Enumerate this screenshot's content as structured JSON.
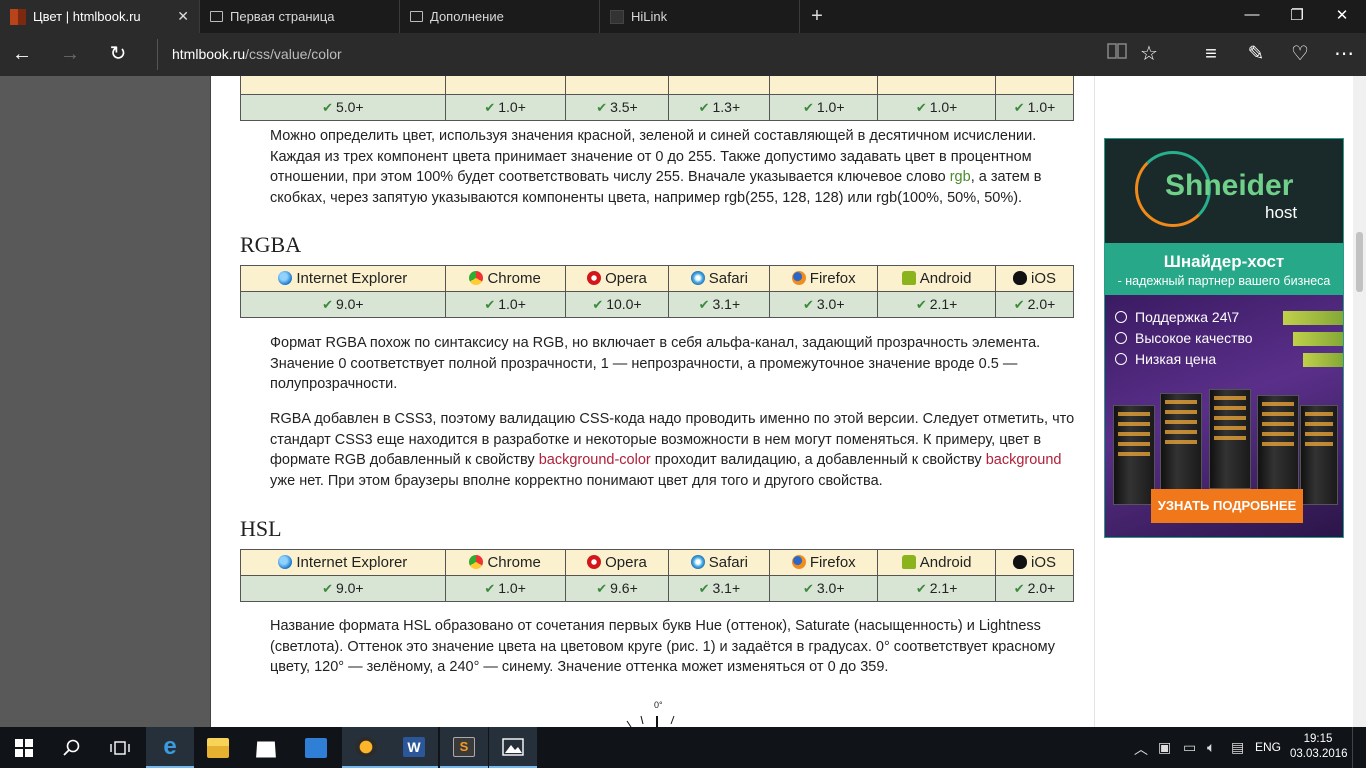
{
  "browser": {
    "tabs": [
      {
        "title": "Цвет | htmlbook.ru",
        "active": true
      },
      {
        "title": "Первая страница",
        "active": false
      },
      {
        "title": "Дополнение",
        "active": false
      },
      {
        "title": "HiLink",
        "active": false
      }
    ],
    "new_tab": "+",
    "window": {
      "minimize": "—",
      "restore": "❐",
      "close": "✕"
    },
    "nav": {
      "back": "←",
      "forward": "→",
      "refresh": "↻"
    },
    "url_domain": "htmlbook.ru",
    "url_path": "/css/value/color",
    "toolbar": {
      "reading": "reading-view-icon",
      "favorite": "☆",
      "hub": "≡",
      "notes": "✎",
      "share": "♡",
      "more": "⋯"
    }
  },
  "browsers_header": [
    "Internet Explorer",
    "Chrome",
    "Opera",
    "Safari",
    "Firefox",
    "Android",
    "iOS"
  ],
  "tables": {
    "rgb": {
      "values": [
        "5.0+",
        "1.0+",
        "3.5+",
        "1.3+",
        "1.0+",
        "1.0+",
        "1.0+"
      ]
    },
    "rgba": {
      "values": [
        "9.0+",
        "1.0+",
        "10.0+",
        "3.1+",
        "3.0+",
        "2.1+",
        "2.0+"
      ]
    },
    "hsl": {
      "values": [
        "9.0+",
        "1.0+",
        "9.6+",
        "3.1+",
        "3.0+",
        "2.1+",
        "2.0+"
      ]
    }
  },
  "paragraphs": {
    "rgb_p1_a": "Можно определить цвет, используя значения красной, зеленой и синей составляющей в десятичном исчислении. Каждая из трех компонент цвета принимает значение от 0 до 255. Также допустимо задавать цвет в процентном отношении, при этом 100% будет соответствовать числу 255. Вначале указывается ключевое слово ",
    "rgb_p1_link": "rgb",
    "rgb_p1_b": ", а затем в скобках, через запятую указываются компоненты цвета, например rgb(255, 128, 128) или rgb(100%, 50%, 50%).",
    "rgba_heading": "RGBA",
    "rgba_p1": "Формат RGBA похож по синтаксису на RGB, но включает в себя альфа-канал, задающий прозрачность элемента. Значение 0 соответствует полной прозрачности, 1 — непрозрачности, а промежуточное значение вроде 0.5 — полупрозрачности.",
    "rgba_p2_a": "RGBA добавлен в CSS3, поэтому валидацию CSS-кода надо проводить именно по этой версии. Следует отметить, что стандарт CSS3 еще находится в разработке и некоторые возможности в нем могут поменяться. К примеру, цвет в формате RGB добавленный к свойству ",
    "rgba_p2_link1": "background-color",
    "rgba_p2_b": " проходит валидацию, а добавленный к свойству ",
    "rgba_p2_link2": "background",
    "rgba_p2_c": " уже нет. При этом браузеры вполне корректно понимают цвет для того и другого свойства.",
    "hsl_heading": "HSL",
    "hsl_p1": "Название формата HSL образовано от сочетания первых букв Hue (оттенок), Saturate (насыщенность) и Lightness (светлота). Оттенок это значение цвета на цветовом круге (рис. 1) и задаётся в градусах. 0° соответствует красному цвету, 120° — зелёному, а 240° — синему. Значение оттенка может изменяться от 0 до 359.",
    "diagram_label": "0°"
  },
  "ad": {
    "brand": "Shneider",
    "brand_sub": "host",
    "title": "Шнайдер-хост",
    "subtitle": "- надежный партнер вашего бизнеса",
    "features": [
      "Поддержка 24\\7",
      "Высокое качество",
      "Низкая цена"
    ],
    "button": "УЗНАТЬ ПОДРОБНЕЕ"
  },
  "taskbar": {
    "lang": "ENG",
    "time": "19:15",
    "date": "03.03.2016"
  }
}
